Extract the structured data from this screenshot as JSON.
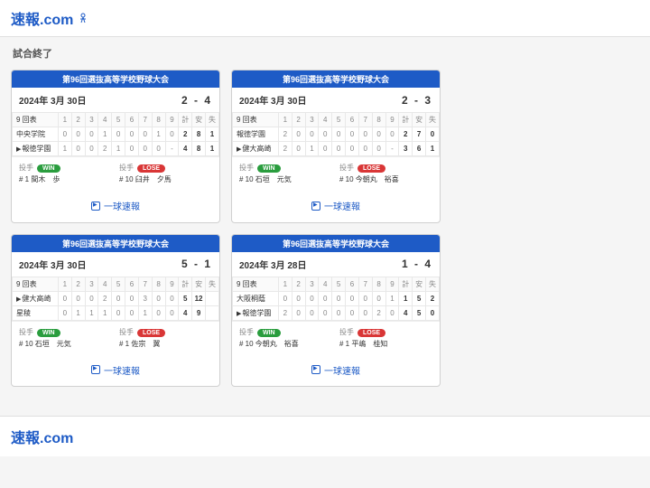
{
  "site": {
    "name": "速報.com"
  },
  "section": {
    "title": "試合終了"
  },
  "labels": {
    "innings": [
      "1",
      "2",
      "3",
      "4",
      "5",
      "6",
      "7",
      "8",
      "9"
    ],
    "totals": [
      "計",
      "安",
      "失"
    ],
    "pitcher": "投手",
    "win": "WIN",
    "lose": "LOSE",
    "link": "一球速報",
    "inning_header": "9 回表"
  },
  "games": [
    {
      "tournament": "第96回選抜高等学校野球大会",
      "date": "2024年 3月 30日",
      "score": "2 - 4",
      "teams": [
        {
          "name": "中央学院",
          "line": [
            "0",
            "0",
            "0",
            "1",
            "0",
            "0",
            "0",
            "1",
            "0"
          ],
          "totals": [
            "2",
            "8",
            "1"
          ],
          "winner": false
        },
        {
          "name": "報徳学園",
          "line": [
            "1",
            "0",
            "0",
            "2",
            "1",
            "0",
            "0",
            "0",
            "-"
          ],
          "totals": [
            "4",
            "8",
            "1"
          ],
          "winner": true
        }
      ],
      "winP": {
        "no": "# 1 間木",
        "name": "歩"
      },
      "loseP": {
        "no": "# 10 臼井",
        "name": "夕馬"
      }
    },
    {
      "tournament": "第96回選抜高等学校野球大会",
      "date": "2024年 3月 30日",
      "score": "2 - 3",
      "teams": [
        {
          "name": "報徳学園",
          "line": [
            "2",
            "0",
            "0",
            "0",
            "0",
            "0",
            "0",
            "0",
            "0"
          ],
          "totals": [
            "2",
            "7",
            "0"
          ],
          "winner": false
        },
        {
          "name": "健大高崎",
          "line": [
            "2",
            "0",
            "1",
            "0",
            "0",
            "0",
            "0",
            "0",
            "-"
          ],
          "totals": [
            "3",
            "6",
            "1"
          ],
          "winner": true
        }
      ],
      "winP": {
        "no": "# 10 石垣",
        "name": "元気"
      },
      "loseP": {
        "no": "# 10 今朝丸",
        "name": "裕喜"
      }
    },
    {
      "tournament": "第96回選抜高等学校野球大会",
      "date": "2024年 3月 30日",
      "score": "5 - 1",
      "teams": [
        {
          "name": "健大高崎",
          "line": [
            "0",
            "0",
            "0",
            "2",
            "0",
            "0",
            "3",
            "0",
            "0"
          ],
          "totals": [
            "5",
            "12",
            ""
          ],
          "winner": true
        },
        {
          "name": "星稜",
          "line": [
            "0",
            "1",
            "1",
            "1",
            "0",
            "0",
            "1",
            "0",
            "0"
          ],
          "totals": [
            "4",
            "9",
            ""
          ],
          "winner": false
        }
      ],
      "winP": {
        "no": "# 10 石垣",
        "name": "元気"
      },
      "loseP": {
        "no": "# 1 佐宗",
        "name": "翼"
      }
    },
    {
      "tournament": "第96回選抜高等学校野球大会",
      "date": "2024年 3月 28日",
      "score": "1 - 4",
      "teams": [
        {
          "name": "大阪桐蔭",
          "line": [
            "0",
            "0",
            "0",
            "0",
            "0",
            "0",
            "0",
            "0",
            "1"
          ],
          "totals": [
            "1",
            "5",
            "2"
          ],
          "winner": false
        },
        {
          "name": "報徳学園",
          "line": [
            "2",
            "0",
            "0",
            "0",
            "0",
            "0",
            "0",
            "2",
            "0"
          ],
          "totals": [
            "4",
            "5",
            "0"
          ],
          "winner": true
        }
      ],
      "winP": {
        "no": "# 10 今朝丸",
        "name": "裕喜"
      },
      "loseP": {
        "no": "# 1 平嶋",
        "name": "桂知"
      }
    }
  ]
}
